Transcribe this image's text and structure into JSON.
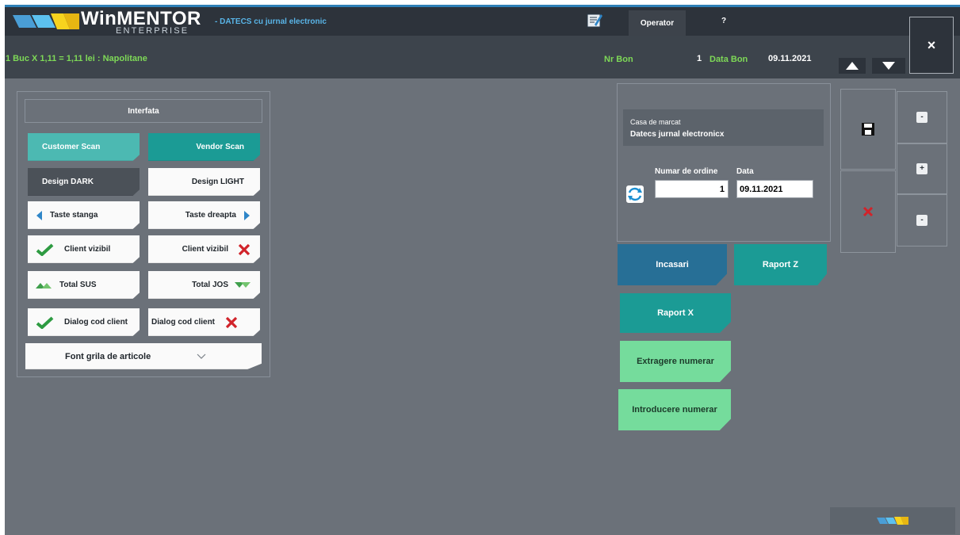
{
  "header": {
    "brand": "WinMENTOR",
    "brand_sub": "ENTERPRISE",
    "db_name": "- DATECS cu jurnal electronic",
    "operator_label": "Operator",
    "help_label": "?",
    "close_label": "×"
  },
  "subbar": {
    "status_text": "1 Buc X 1,11  = 1,11 lei : Napolitane",
    "nr_bon_label": "Nr Bon",
    "nr_bon_value": "1",
    "data_bon_label": "Data Bon",
    "data_bon_value": "09.11.2021"
  },
  "interface_panel": {
    "title": "Interfata",
    "customer_scan": "Customer Scan",
    "vendor_scan": "Vendor Scan",
    "design_dark": "Design DARK",
    "design_light": "Design LIGHT",
    "keys_left": "Taste stanga",
    "keys_right": "Taste dreapta",
    "client_visible_on": "Client vizibil",
    "client_visible_off": "Client vizibil",
    "total_up": "Total SUS",
    "total_down": "Total JOS",
    "dialog_on": "Dialog cod client",
    "dialog_off": "Dialog cod client",
    "font_grid": "Font grila de articole"
  },
  "register_panel": {
    "casa_label": "Casa de marcat",
    "casa_value": "Datecs jurnal electronicx",
    "order_label": "Numar de ordine",
    "order_value": "1",
    "date_label": "Data",
    "date_value": "09.11.2021"
  },
  "actions": {
    "incasari": "Incasari",
    "raport_z": "Raport Z",
    "raport_x": "Raport X",
    "extragere": "Extragere numerar",
    "introducere": "Introducere numerar"
  },
  "side_toolbar": {
    "collapse_label": "-",
    "add_label": "+",
    "expand_label": "-"
  },
  "colors": {
    "topbar": "#2d333b",
    "background": "#6b7179",
    "teal": "#1b9b95",
    "blue": "#276f96",
    "green": "#75dc9c",
    "accent_green": "#7ed957",
    "link_blue": "#59b5e8"
  },
  "icons": [
    "logo-icon",
    "note-icon",
    "arrow-up-icon",
    "arrow-down-icon",
    "close-icon",
    "refresh-icon",
    "save-icon",
    "delete-icon",
    "check-icon",
    "cross-icon",
    "triangle-left-icon",
    "triangle-right-icon",
    "total-up-icon",
    "total-down-icon",
    "chevron-down-icon"
  ]
}
